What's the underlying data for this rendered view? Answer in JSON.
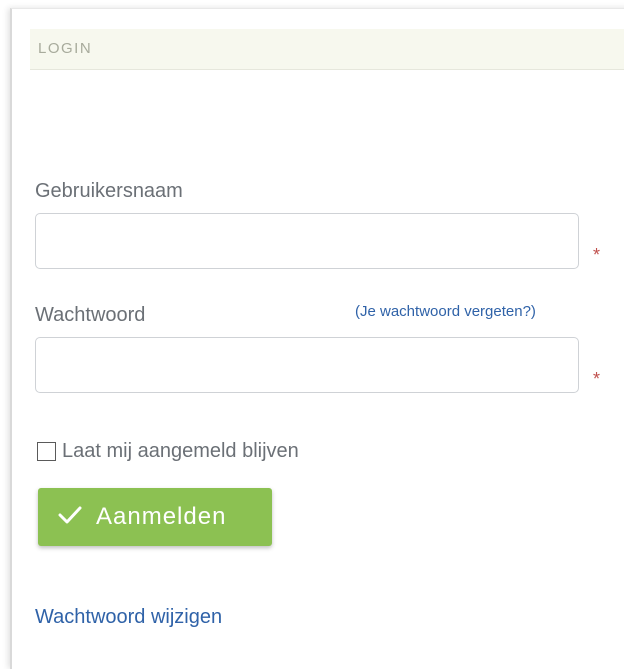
{
  "panel": {
    "title": "LOGIN"
  },
  "form": {
    "username_label": "Gebruikersnaam",
    "username_value": "",
    "password_label": "Wachtwoord",
    "password_value": "",
    "required_marker": "*",
    "forgot_link": "(Je wachtwoord vergeten?)",
    "remember_label": "Laat mij aangemeld blijven",
    "remember_checked": false,
    "submit_label": "Aanmelden",
    "change_password_link": "Wachtwoord wijzigen"
  },
  "colors": {
    "accent_green": "#8cc152",
    "link_blue": "#2f62a8",
    "required_red": "#c0504d",
    "header_bg": "#f7f8ee"
  },
  "icons": {
    "submit": "checkmark-icon"
  }
}
